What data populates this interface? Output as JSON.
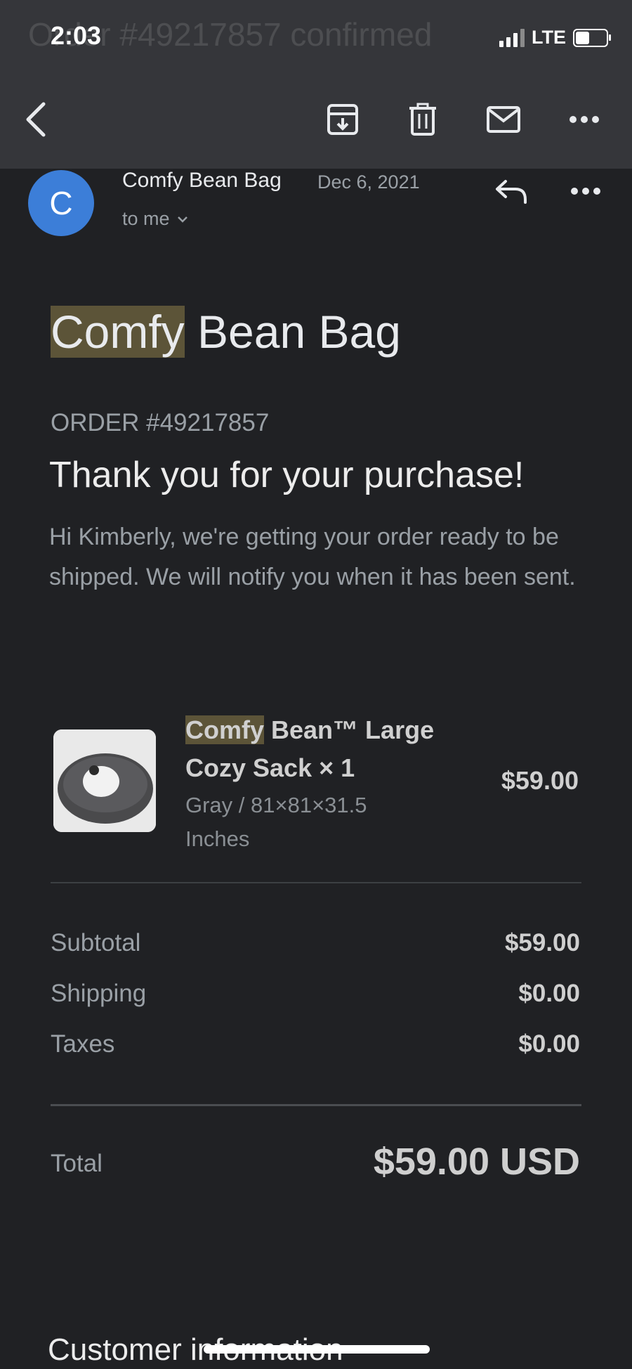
{
  "status_bar": {
    "time": "2:03",
    "network": "LTE",
    "battery_level": 0.45
  },
  "header": {
    "ghost_subject": "Order #49217857 confirmed",
    "icons": [
      "back-arrow-icon",
      "archive-icon",
      "trash-icon",
      "mail-icon",
      "more-icon"
    ]
  },
  "email": {
    "sender_initial": "C",
    "sender_name": "Comfy Bean Bag",
    "date": "Dec 6, 2021",
    "recipient": "to me",
    "avatar_color": "#3c7ed8"
  },
  "body": {
    "brand_highlight": "Comfy",
    "brand_rest": " Bean Bag",
    "order_number": "ORDER #49217857",
    "thanks": "Thank you for your purchase!",
    "intro": "Hi Kimberly, we're getting your order ready to be shipped. We will notify you when it has been sent."
  },
  "line_item": {
    "title_highlight": "Comfy",
    "title_rest": " Bean™ Large Cozy Sack × 1",
    "variant": "Gray / 81×81×31.5 Inches",
    "price": "$59.00"
  },
  "summary": {
    "subtotal_label": "Subtotal",
    "subtotal_value": "$59.00",
    "shipping_label": "Shipping",
    "shipping_value": "$0.00",
    "taxes_label": "Taxes",
    "taxes_value": "$0.00",
    "total_label": "Total",
    "total_value": "$59.00 USD"
  },
  "footer": {
    "section_title": "Customer information"
  },
  "colors": {
    "background": "#202124",
    "toolbar": "#35363a",
    "highlight": "#5c5438"
  }
}
